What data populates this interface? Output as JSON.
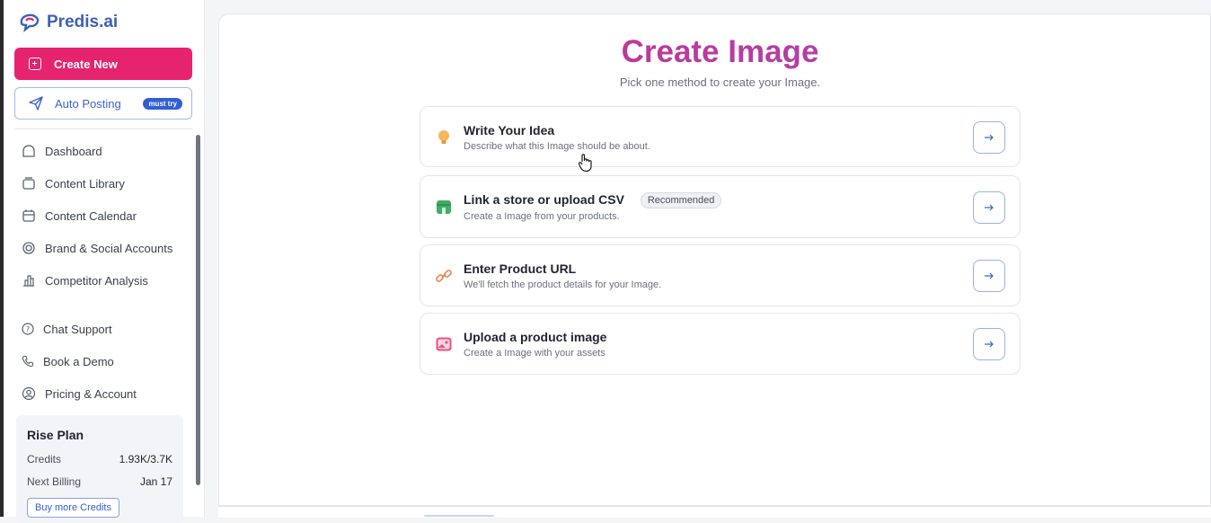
{
  "sidebar": {
    "brand": "Predis.ai",
    "create_new": "Create New",
    "auto_posting": "Auto Posting",
    "must_try": "must try",
    "nav": [
      {
        "label": "Dashboard",
        "icon": "home-icon"
      },
      {
        "label": "Content Library",
        "icon": "library-icon"
      },
      {
        "label": "Content Calendar",
        "icon": "calendar-icon"
      },
      {
        "label": "Brand & Social Accounts",
        "icon": "brand-icon"
      },
      {
        "label": "Competitor Analysis",
        "icon": "chart-icon"
      }
    ],
    "nav2": [
      {
        "label": "Chat Support",
        "icon": "help-icon"
      },
      {
        "label": "Book a Demo",
        "icon": "phone-icon"
      },
      {
        "label": "Pricing & Account",
        "icon": "user-icon"
      }
    ],
    "plan": {
      "name": "Rise Plan",
      "credits_label": "Credits",
      "credits_value": "1.93K/3.7K",
      "billing_label": "Next Billing",
      "billing_value": "Jan 17",
      "buy_label": "Buy more Credits"
    }
  },
  "main": {
    "title": "Create Image",
    "subtitle": "Pick one method to create your Image.",
    "options": [
      {
        "title": "Write Your Idea",
        "desc": "Describe what this Image should be about.",
        "icon": "lightbulb-icon"
      },
      {
        "title": "Link a store or upload CSV",
        "desc": "Create a Image from your products.",
        "badge": "Recommended",
        "icon": "store-icon"
      },
      {
        "title": "Enter Product URL",
        "desc": "We'll fetch the product details for your Image.",
        "icon": "link-icon"
      },
      {
        "title": "Upload a product image",
        "desc": "Create a Image with your assets",
        "icon": "image-icon"
      }
    ]
  },
  "colors": {
    "accent": "#e5236e",
    "brand_blue": "#3b63c9"
  }
}
